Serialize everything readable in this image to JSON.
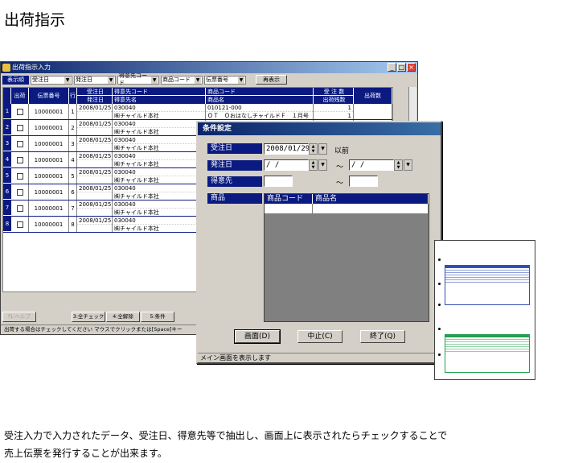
{
  "page": {
    "title": "出荷指示"
  },
  "main_window": {
    "title": "出荷指示入力",
    "toolbar": {
      "display_order_label": "表示順",
      "selects": [
        "受注日",
        "発注日",
        "得意先コード",
        "商品コード",
        "伝票番号"
      ],
      "redisplay_button": "再表示"
    },
    "grid": {
      "headers": {
        "ship": "出荷",
        "slip_no": "伝票番号",
        "line": "行",
        "order_date": "受注日",
        "delivery_date": "発注日",
        "customer_code": "得意先コード",
        "customer_name": "得意先名",
        "product_code": "商品コード",
        "product_name": "商品名",
        "order_qty": "受 注 数",
        "shipped_qty": "出荷残数",
        "ship_qty": "出荷数"
      },
      "rows": [
        {
          "n": "1",
          "slip": "10000001",
          "line": "1",
          "date": "2008/01/25",
          "cust_code": "030040",
          "cust_name": "㈱チャイルド本社",
          "prod_code": "010121-000",
          "prod_name": "ＯＴ　ＯおはなしチャイルドＦ　１月号",
          "qty": "1",
          "rem": "1"
        },
        {
          "n": "2",
          "slip": "10000001",
          "line": "2",
          "date": "2008/01/25",
          "cust_code": "030040",
          "cust_name": "㈱チャイルド本社",
          "prod_code": "",
          "prod_name": "",
          "qty": "",
          "rem": ""
        },
        {
          "n": "3",
          "slip": "10000001",
          "line": "3",
          "date": "2008/01/25",
          "cust_code": "030040",
          "cust_name": "㈱チャイルド本社",
          "prod_code": "",
          "prod_name": "",
          "qty": "",
          "rem": ""
        },
        {
          "n": "4",
          "slip": "10000001",
          "line": "4",
          "date": "2008/01/25",
          "cust_code": "030040",
          "cust_name": "㈱チャイルド本社",
          "prod_code": "",
          "prod_name": "",
          "qty": "",
          "rem": ""
        },
        {
          "n": "5",
          "slip": "10000001",
          "line": "5",
          "date": "2008/01/25",
          "cust_code": "030040",
          "cust_name": "㈱チャイルド本社",
          "prod_code": "",
          "prod_name": "",
          "qty": "",
          "rem": ""
        },
        {
          "n": "6",
          "slip": "10000001",
          "line": "6",
          "date": "2008/01/25",
          "cust_code": "030040",
          "cust_name": "㈱チャイルド本社",
          "prod_code": "",
          "prod_name": "",
          "qty": "",
          "rem": ""
        },
        {
          "n": "7",
          "slip": "10000001",
          "line": "7",
          "date": "2008/01/25",
          "cust_code": "030040",
          "cust_name": "㈱チャイルド本社",
          "prod_code": "",
          "prod_name": "",
          "qty": "",
          "rem": ""
        },
        {
          "n": "8",
          "slip": "10000001",
          "line": "8",
          "date": "2008/01/25",
          "cust_code": "030040",
          "cust_name": "㈱チャイルド本社",
          "prod_code": "",
          "prod_name": "",
          "qty": "",
          "rem": ""
        }
      ]
    },
    "fkeys": [
      "f1:ヘルプ",
      "3:全チェック",
      "4:全解除",
      "5:条件"
    ],
    "status": "出荷する場合はチェックしてください マウスでクリックまたは[Space]キー"
  },
  "dialog": {
    "title": "条件設定",
    "order_date_label": "受注日",
    "order_date_value": "2008/01/29",
    "order_date_suffix": "以前",
    "delivery_label": "発注日",
    "delivery_from": " /  / ",
    "delivery_to": " /  / ",
    "tilde": "～",
    "customer_label": "得意先",
    "product_label": "商品",
    "product_code_header": "商品コード",
    "product_name_header": "商品名",
    "btn_screen": "画面(D)",
    "btn_cancel": "中止(C)",
    "btn_exit": "終了(Q)",
    "status": "メイン画面を表示します"
  },
  "caption": {
    "line1": "受注入力で入力されたデータ、受注日、得意先等で抽出し、画面上に表示されたらチェックすることで",
    "line2": "売上伝票を発行することが出来ます。"
  }
}
